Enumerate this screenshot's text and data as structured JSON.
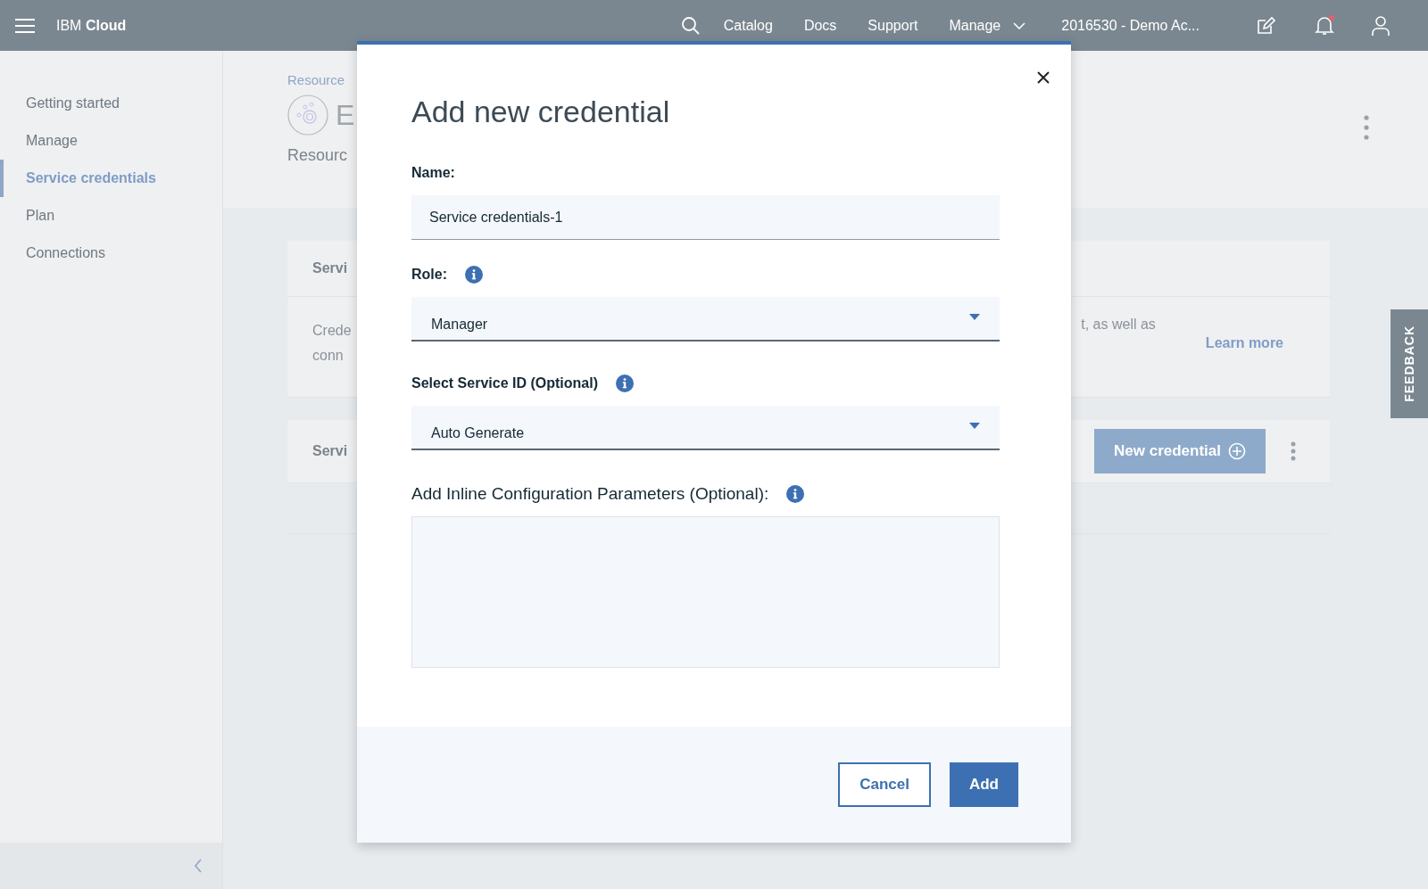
{
  "header": {
    "brand": "IBM **Cloud**",
    "nav": [
      {
        "label": "Catalog",
        "kind": "link"
      },
      {
        "label": "Docs",
        "kind": "link"
      },
      {
        "label": "Support",
        "kind": "link"
      },
      {
        "label": "Manage",
        "kind": "menu"
      }
    ],
    "account": "2016530 - Demo Ac...",
    "notifications_unread": true
  },
  "sidebar": {
    "items": [
      {
        "label": "Getting started",
        "selected": false
      },
      {
        "label": "Manage",
        "selected": false
      },
      {
        "label": "Service credentials",
        "selected": true
      },
      {
        "label": "Plan",
        "selected": false
      },
      {
        "label": "Connections",
        "selected": false
      }
    ]
  },
  "page": {
    "breadcrumb": "Resource",
    "title": "E",
    "subtitle": "Resourc",
    "cards": [
      {
        "heading": "Servi",
        "lines": [
          "Crede",
          "conn"
        ],
        "trailing_text": "t, as well as",
        "link": "Learn more"
      },
      {
        "heading": "Servi",
        "button": "New credential"
      }
    ]
  },
  "feedback": "FEEDBACK",
  "modal": {
    "title": "Add new credential",
    "fields": [
      {
        "kind": "text",
        "label": "Name:",
        "value": "Service credentials-1",
        "info": false
      },
      {
        "kind": "select",
        "label": "Role:",
        "value": "Manager",
        "info": true
      },
      {
        "kind": "select",
        "label": "Select Service ID (Optional)",
        "value": "Auto Generate",
        "info": true
      },
      {
        "kind": "textarea",
        "label": "Add Inline Configuration Parameters (Optional):",
        "info": true
      }
    ],
    "buttons": [
      {
        "label": "Cancel",
        "kind": "secondary"
      },
      {
        "label": "Add",
        "kind": "primary"
      }
    ]
  }
}
